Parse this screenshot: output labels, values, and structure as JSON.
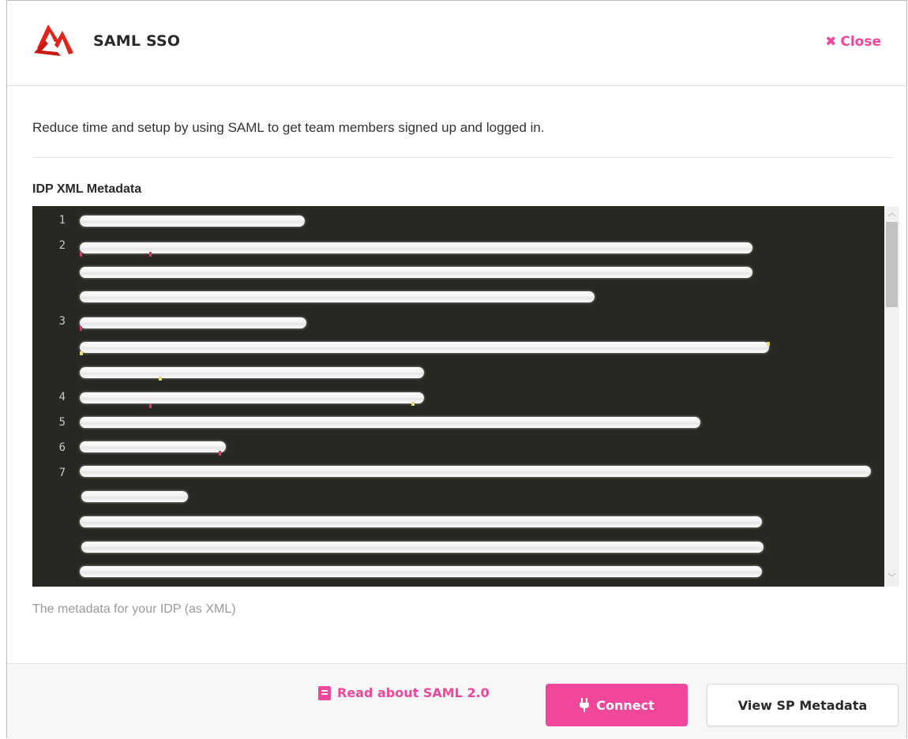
{
  "header": {
    "title": "SAML SSO",
    "close_label": "Close"
  },
  "intro_text": "Reduce time and setup by using SAML to get team members signed up and logged in.",
  "metadata_field": {
    "label": "IDP XML Metadata",
    "help_text": "The metadata for your IDP (as XML)",
    "line_numbers": [
      "1",
      "2",
      "3",
      "4",
      "5",
      "6",
      "7"
    ]
  },
  "footer": {
    "read_link": "Read about SAML 2.0",
    "connect_label": "Connect",
    "view_sp_label": "View SP Metadata"
  },
  "colors": {
    "accent": "#f0479b",
    "editor_bg": "#272822"
  },
  "icons": {
    "logo": "saml-logo-icon",
    "close": "close-x-icon",
    "book": "book-icon",
    "plug": "plug-icon"
  }
}
